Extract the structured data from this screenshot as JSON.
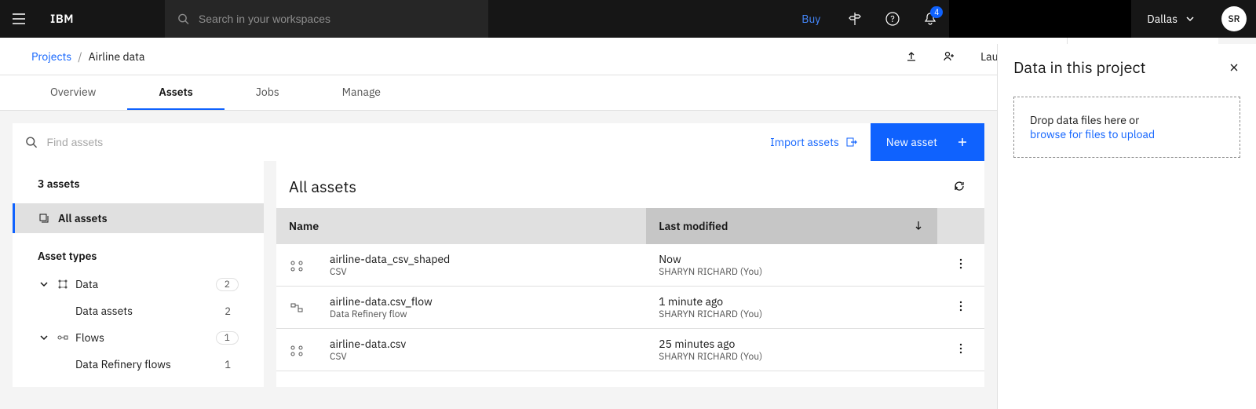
{
  "topbar": {
    "logo": "IBM",
    "search_placeholder": "Search in your workspaces",
    "buy_label": "Buy",
    "notif_count": "4",
    "region": "Dallas",
    "avatar": "SR"
  },
  "breadcrumb": {
    "root": "Projects",
    "current": "Airline data"
  },
  "subheader": {
    "launch_ide": "Launch IDE"
  },
  "tabs": {
    "overview": "Overview",
    "assets": "Assets",
    "jobs": "Jobs",
    "manage": "Manage"
  },
  "toolbar": {
    "find_placeholder": "Find assets",
    "import_label": "Import assets",
    "new_asset_label": "New asset"
  },
  "sidebar": {
    "count_label": "3 assets",
    "all_assets": "All assets",
    "asset_types_label": "Asset types",
    "tree": [
      {
        "label": "Data",
        "count": "2",
        "sub": {
          "label": "Data assets",
          "count": "2"
        }
      },
      {
        "label": "Flows",
        "count": "1",
        "sub": {
          "label": "Data Refinery flows",
          "count": "1"
        }
      }
    ]
  },
  "table": {
    "heading": "All assets",
    "col_name": "Name",
    "col_modified": "Last modified",
    "rows": [
      {
        "name": "airline-data_csv_shaped",
        "type": "CSV",
        "time": "Now",
        "user": "SHARYN RICHARD (You)",
        "icon": "data"
      },
      {
        "name": "airline-data.csv_flow",
        "type": "Data Refinery flow",
        "time": "1 minute ago",
        "user": "SHARYN RICHARD (You)",
        "icon": "flow"
      },
      {
        "name": "airline-data.csv",
        "type": "CSV",
        "time": "25 minutes ago",
        "user": "SHARYN RICHARD (You)",
        "icon": "data"
      }
    ]
  },
  "right": {
    "heading": "Data in this project",
    "drop_l1": "Drop data files here or",
    "drop_l2": "browse for files to upload"
  }
}
